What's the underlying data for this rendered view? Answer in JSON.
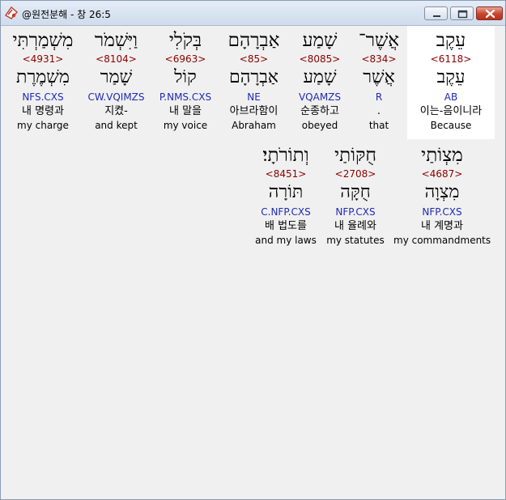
{
  "window": {
    "title": "@원전분해 - 창 26:5",
    "icon": "document-compare-icon"
  },
  "colors": {
    "strong_number": "#8b0000",
    "parsing": "#1f2ab8",
    "highlight": "#ffffff"
  },
  "rows": [
    {
      "words": [
        {
          "heb": "עֵקֶב",
          "strong": "<6118>",
          "lemma": "עֵקֶב",
          "parse": "AB",
          "korean": "이는-음이니라",
          "english": "Because",
          "selected": true
        },
        {
          "heb": "אֲשֶׁר־",
          "strong": "<834>",
          "lemma": "אֲשֶׁר",
          "parse": "R",
          "korean": ".",
          "english": "that",
          "selected": false
        },
        {
          "heb": "שָׁמַע",
          "strong": "<8085>",
          "lemma": "שָׁמַע",
          "parse": "VQAMZS",
          "korean": "순종하고",
          "english": "obeyed",
          "selected": false
        },
        {
          "heb": "אַבְרָהָם",
          "strong": "<85>",
          "lemma": "אַבְרָהָם",
          "parse": "NE",
          "korean": "아브라함이",
          "english": "Abraham",
          "selected": false
        },
        {
          "heb": "בְּקֹלִי",
          "strong": "<6963>",
          "lemma": "קוֹל",
          "parse": "P.NMS.CXS",
          "korean": "내 말을",
          "english": "my voice",
          "selected": false
        },
        {
          "heb": "וַיִּשְׁמֹר",
          "strong": "<8104>",
          "lemma": "שָׁמַר",
          "parse": "CW.VQIMZS",
          "korean": "지켰-",
          "english": "and kept",
          "selected": false
        },
        {
          "heb": "מִשְׁמַרְתִּי",
          "strong": "<4931>",
          "lemma": "מִשְׁמֶרֶת",
          "parse": "NFS.CXS",
          "korean": "내 명령과",
          "english": "my charge",
          "selected": false
        }
      ]
    },
    {
      "words": [
        {
          "heb": "מִצְוֹתַי",
          "strong": "<4687>",
          "lemma": "מִצְוָה",
          "parse": "NFP.CXS",
          "korean": "내 계명과",
          "english": "my commandments",
          "selected": false
        },
        {
          "heb": "חֻקּוֹתַי",
          "strong": "<2708>",
          "lemma": "חֻקָּה",
          "parse": "NFP.CXS",
          "korean": "내 율례와",
          "english": "my statutes",
          "selected": false
        },
        {
          "heb": "וְתוֹרֹתָי׃",
          "strong": "<8451>",
          "lemma": "תּוֹרָה",
          "parse": "C.NFP.CXS",
          "korean": "배 법도를",
          "english": "and my laws",
          "selected": false
        }
      ]
    }
  ]
}
